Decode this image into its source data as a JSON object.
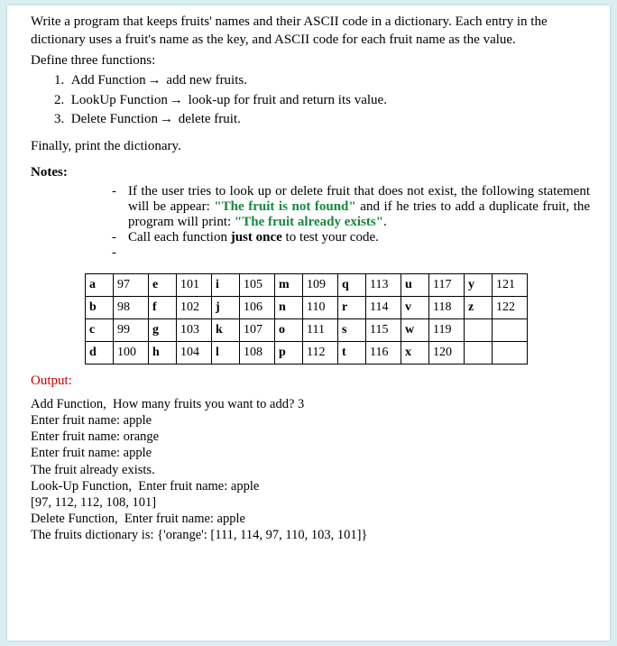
{
  "intro": {
    "line1": "Write a program that keeps fruits' names and their ASCII code in a dictionary. Each entry in the dictionary uses a fruit's name as the key, and ASCII code for each fruit name as the value.",
    "define": "Define three functions:"
  },
  "functions": {
    "f1_num": "1.",
    "f1_name": "Add Function",
    "f1_desc": " add new fruits.",
    "f2_num": "2.",
    "f2_name": "LookUp Function",
    "f2_desc": " look-up for fruit and return its value.",
    "f3_num": "3.",
    "f3_name": "Delete Function",
    "f3_desc": " delete fruit.",
    "arrow": "→"
  },
  "finally_text": "Finally, print the dictionary.",
  "notes_label": "Notes:",
  "notes": {
    "n1a": "If the user tries to look up or delete fruit that does not exist, the following statement will be appear: ",
    "n1_q1": "\"The fruit is not found\"",
    "n1b": " and if he tries to add a duplicate fruit, the program will print: ",
    "n1_q2": "\"The fruit already exists\"",
    "n1c": ".",
    "n2a": "Call each function ",
    "n2_bold": "just once",
    "n2b": " to test your code."
  },
  "ascii": {
    "rows": [
      [
        [
          "a",
          "97"
        ],
        [
          "e",
          "101"
        ],
        [
          "i",
          "105"
        ],
        [
          "m",
          "109"
        ],
        [
          "q",
          "113"
        ],
        [
          "u",
          "117"
        ],
        [
          "y",
          "121"
        ]
      ],
      [
        [
          "b",
          "98"
        ],
        [
          "f",
          "102"
        ],
        [
          "j",
          "106"
        ],
        [
          "n",
          "110"
        ],
        [
          "r",
          "114"
        ],
        [
          "v",
          "118"
        ],
        [
          "z",
          "122"
        ]
      ],
      [
        [
          "c",
          "99"
        ],
        [
          "g",
          "103"
        ],
        [
          "k",
          "107"
        ],
        [
          "o",
          "111"
        ],
        [
          "s",
          "115"
        ],
        [
          "w",
          "119"
        ],
        [
          "",
          ""
        ]
      ],
      [
        [
          "d",
          "100"
        ],
        [
          "h",
          "104"
        ],
        [
          "l",
          "108"
        ],
        [
          "p",
          "112"
        ],
        [
          "t",
          "116"
        ],
        [
          "x",
          "120"
        ],
        [
          "",
          ""
        ]
      ]
    ]
  },
  "output_label": "Output:",
  "console": {
    "l1": "Add Function,  How many fruits you want to add? 3",
    "l2": "Enter fruit name: apple",
    "l3": "Enter fruit name: orange",
    "l4": "Enter fruit name: apple",
    "l5": "The fruit already exists.",
    "l6": "Look-Up Function,  Enter fruit name: apple",
    "l7": "[97, 112, 112, 108, 101]",
    "l8": "Delete Function,  Enter fruit name: apple",
    "l9": "The fruits dictionary is: {'orange': [111, 114, 97, 110, 103, 101]}"
  }
}
